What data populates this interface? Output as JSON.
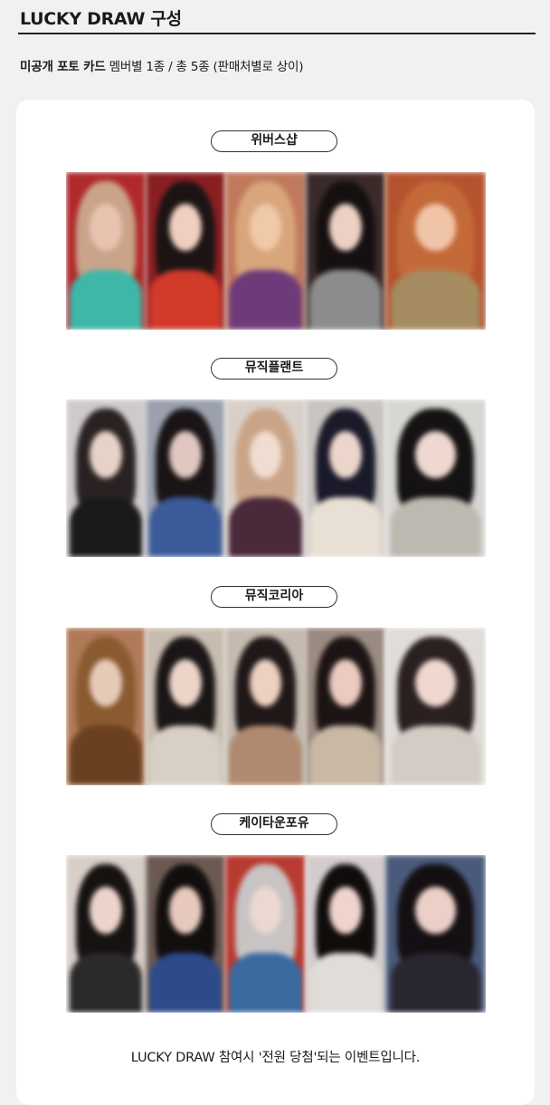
{
  "header": {
    "title": "LUCKY DRAW 구성"
  },
  "subtitle": {
    "bold": "미공개 포토 카드",
    "rest": " 멤버별 1종 / 총 5종 (판매처별로 상이)"
  },
  "sections": [
    {
      "label": "위버스샵",
      "photos": [
        {
          "bg": "#b02a2a",
          "hair": "#c9a48a",
          "face": "#e8c3b0",
          "body": "#3fb7a8"
        },
        {
          "bg": "#8a1f22",
          "hair": "#1c1414",
          "face": "#f0cfc0",
          "body": "#d23a2a"
        },
        {
          "bg": "#c0795c",
          "hair": "#d9a57c",
          "face": "#f0c9a8",
          "body": "#6e3a7a"
        },
        {
          "bg": "#3a2a2a",
          "hair": "#151010",
          "face": "#ecd0c4",
          "body": "#8c8c8c"
        },
        {
          "bg": "#b5532e",
          "hair": "#c46a3a",
          "face": "#f0c4a6",
          "body": "#a58c60"
        }
      ]
    },
    {
      "label": "뮤직플랜트",
      "photos": [
        {
          "bg": "#cfcaca",
          "hair": "#2a2222",
          "face": "#e6d2c8",
          "body": "#1a1a1a"
        },
        {
          "bg": "#9aa0ac",
          "hair": "#1a1416",
          "face": "#e0c8c0",
          "body": "#3a5a9a"
        },
        {
          "bg": "#d8d0c8",
          "hair": "#caa488",
          "face": "#f0dcd0",
          "body": "#4a2a3a"
        },
        {
          "bg": "#c8c4c0",
          "hair": "#1a1a2a",
          "face": "#ecd6cc",
          "body": "#e8e0d4"
        },
        {
          "bg": "#d8d6d2",
          "hair": "#141212",
          "face": "#eed8d0",
          "body": "#bdb8b0"
        }
      ]
    },
    {
      "label": "뮤직코리아",
      "photos": [
        {
          "bg": "#b07a58",
          "hair": "#8a5a30",
          "face": "#e6cab8",
          "body": "#6a4020"
        },
        {
          "bg": "#c8bcb0",
          "hair": "#1a1616",
          "face": "#ecd4c8",
          "body": "#d8d0c4"
        },
        {
          "bg": "#c4bab0",
          "hair": "#201818",
          "face": "#ecd0c0",
          "body": "#b08a70"
        },
        {
          "bg": "#9a8a80",
          "hair": "#1c1414",
          "face": "#eccac0",
          "body": "#c8b8a4"
        },
        {
          "bg": "#e0dcd8",
          "hair": "#2a2020",
          "face": "#f0d8d0",
          "body": "#d4ccc4"
        }
      ]
    },
    {
      "label": "케이타운포유",
      "photos": [
        {
          "bg": "#d8cec8",
          "hair": "#161212",
          "face": "#ecd4ca",
          "body": "#2a2a2a"
        },
        {
          "bg": "#6a5a52",
          "hair": "#120e0e",
          "face": "#e6c8bc",
          "body": "#2e4a8a"
        },
        {
          "bg": "#b83a30",
          "hair": "#c8c4c4",
          "face": "#ecd8d0",
          "body": "#3a6aa0"
        },
        {
          "bg": "#d4cccc",
          "hair": "#100c0c",
          "face": "#eed4cc",
          "body": "#e0dcd8"
        },
        {
          "bg": "#4a5a7a",
          "hair": "#140f12",
          "face": "#ecd0c8",
          "body": "#2a2630"
        }
      ]
    }
  ],
  "footer": {
    "text": "LUCKY DRAW 참여시 '전원 당첨'되는 이벤트입니다."
  }
}
